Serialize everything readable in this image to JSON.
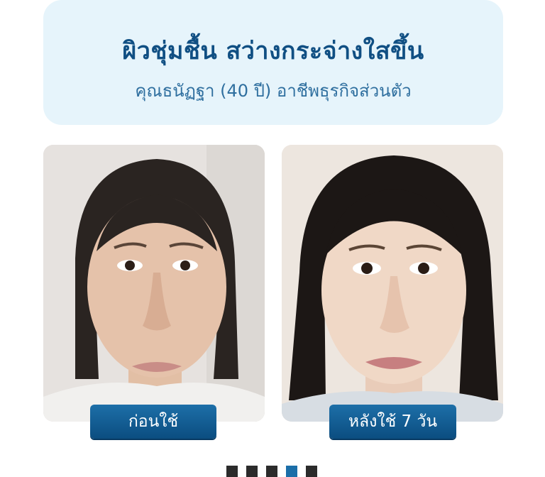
{
  "header": {
    "title": "ผิวชุ่มชื้น สว่างกระจ่างใสขึ้น",
    "subtitle": "คุณธนัฏฐา  (40 ปี) อาชีพธุรกิจส่วนตัว"
  },
  "photos": [
    {
      "label": "ก่อนใช้"
    },
    {
      "label": "หลังใช้ 7 วัน"
    }
  ],
  "pager": {
    "count": 5,
    "active_index": 3
  },
  "colors": {
    "title": "#104f83",
    "subtitle": "#2f6f9f",
    "header_bg": "#e6f4fb",
    "button": "#0b4d80",
    "pager_active": "#1b6ea8",
    "pager_inactive": "#2b2b2b"
  }
}
